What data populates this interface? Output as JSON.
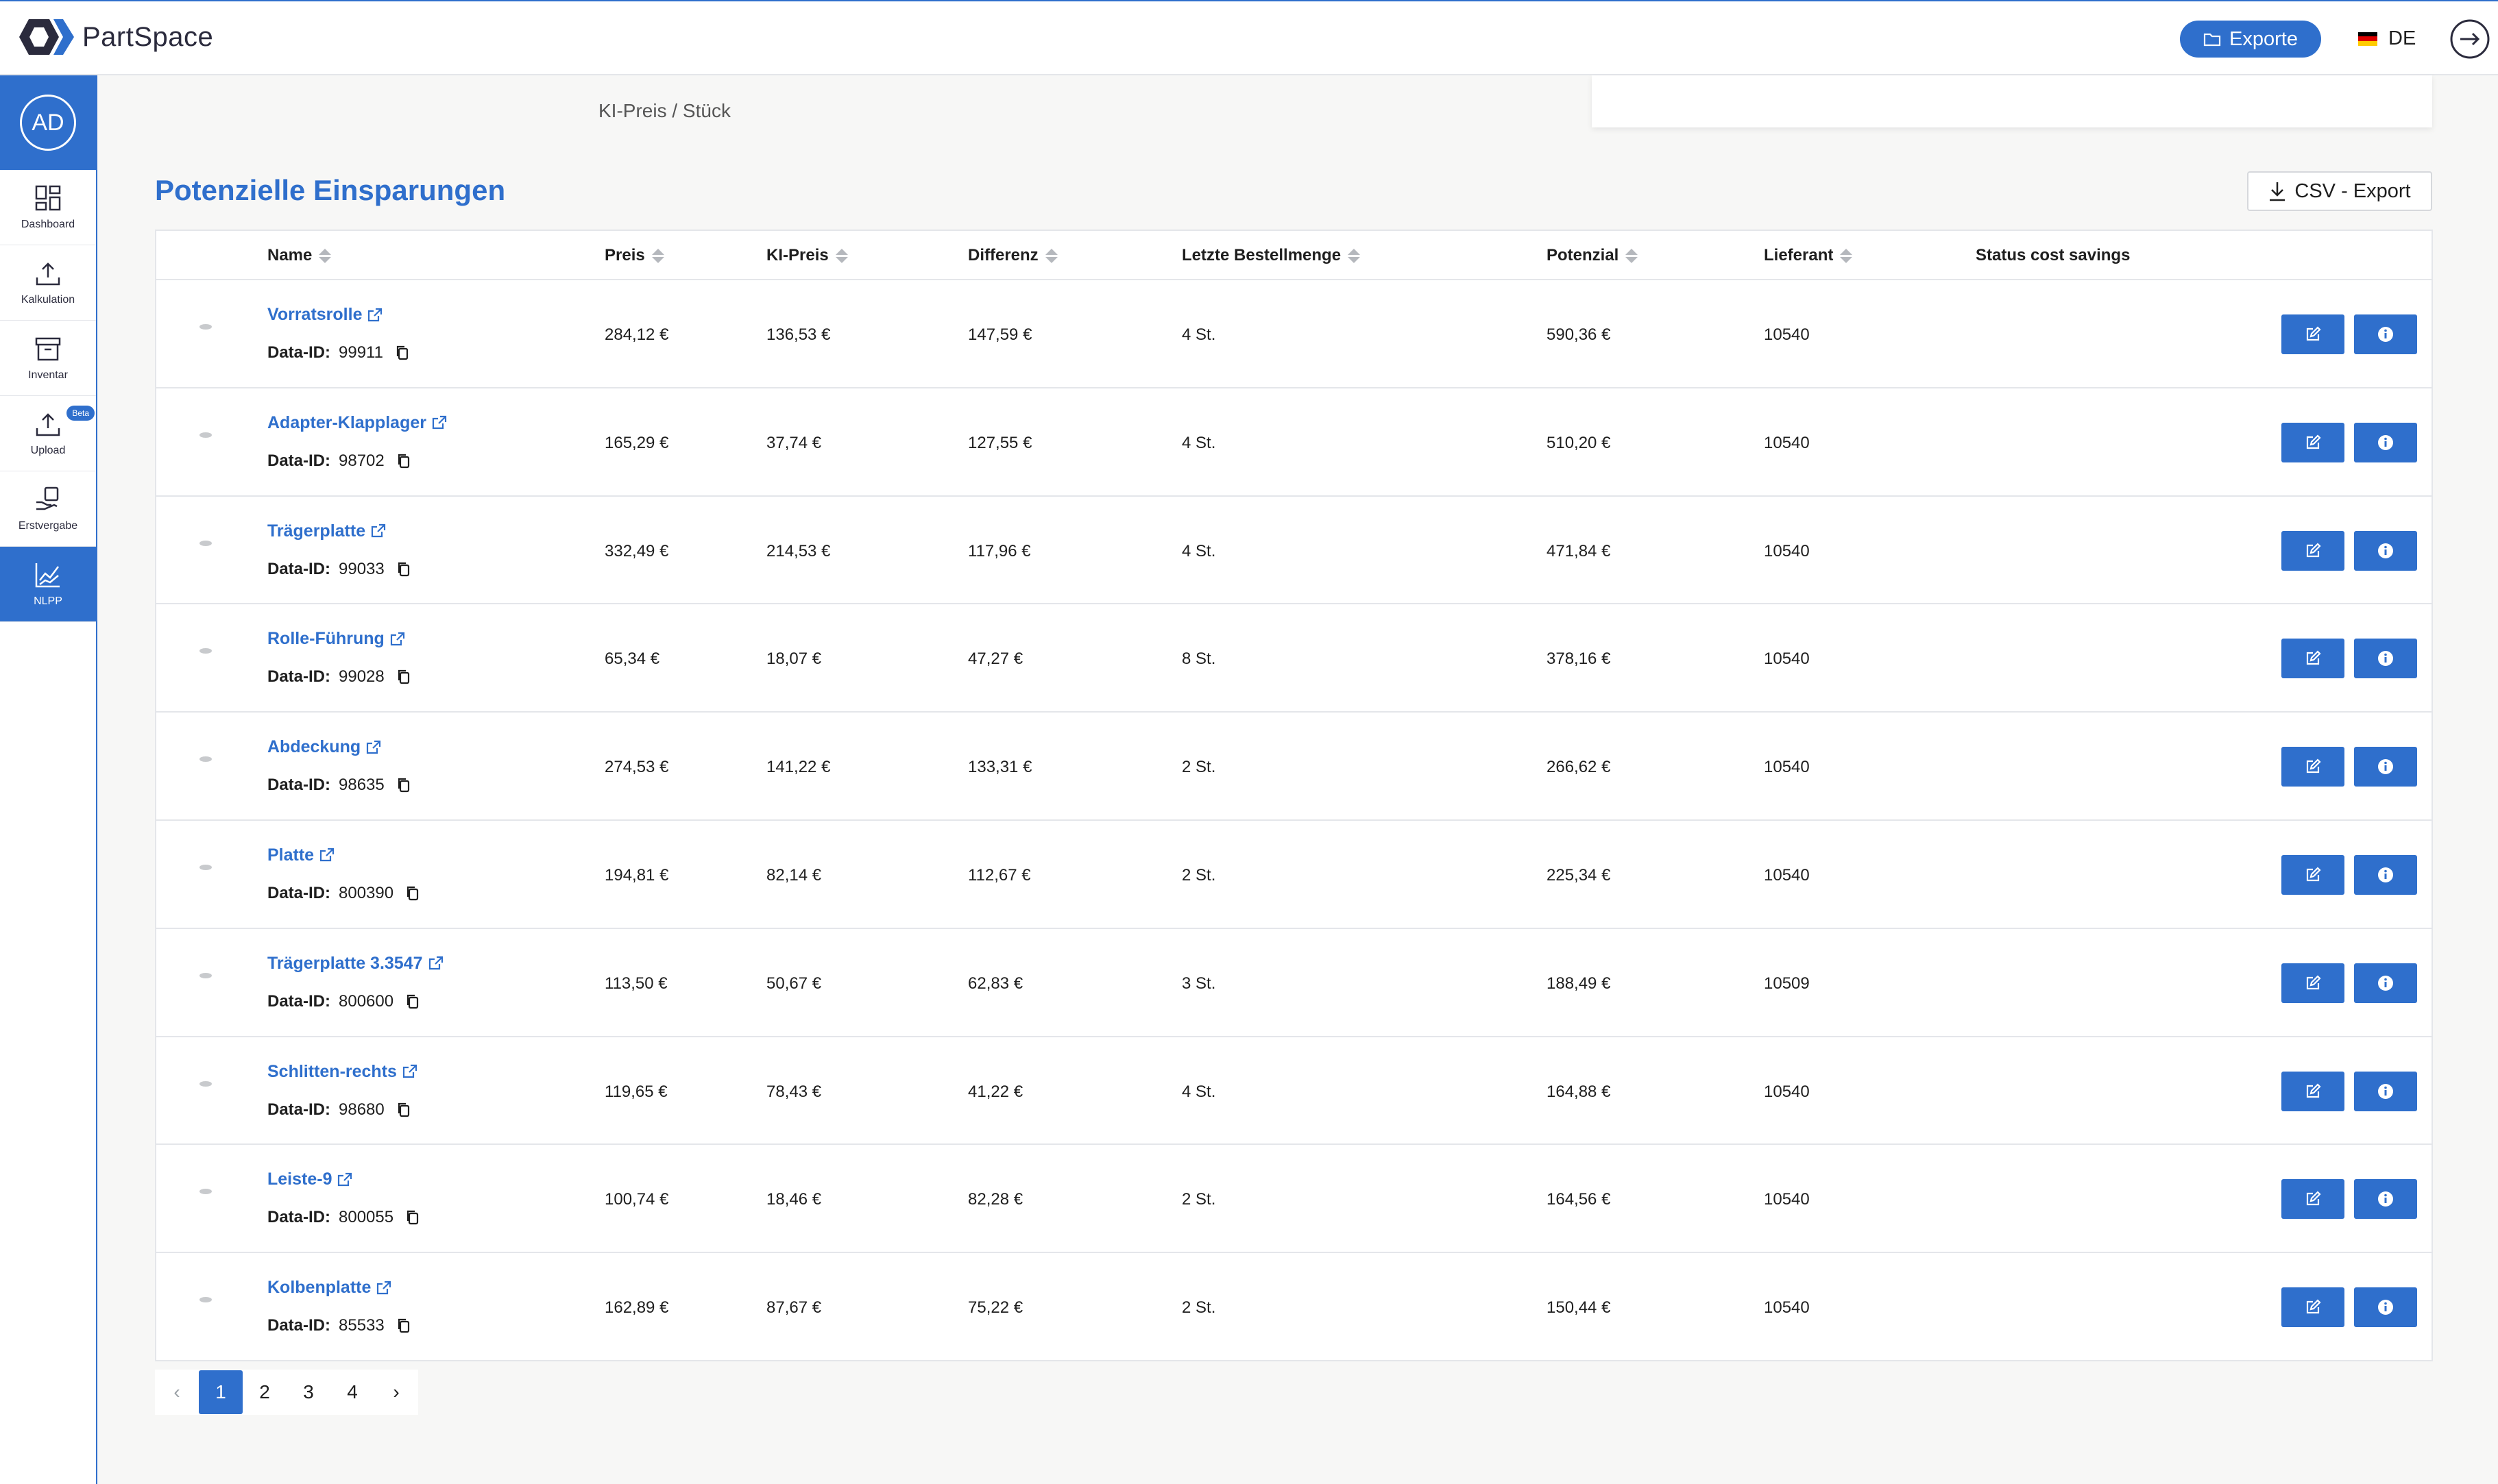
{
  "app": {
    "name": "PartSpace"
  },
  "header": {
    "exports_label": "Exporte",
    "language": "DE"
  },
  "user": {
    "initials": "AD"
  },
  "sidebar": {
    "items": [
      {
        "label": "Dashboard",
        "icon": "dashboard-icon",
        "active": false
      },
      {
        "label": "Kalkulation",
        "icon": "upload-icon",
        "active": false
      },
      {
        "label": "Inventar",
        "icon": "archive-icon",
        "active": false
      },
      {
        "label": "Upload",
        "icon": "upload-icon",
        "active": false,
        "badge": "Beta"
      },
      {
        "label": "Erstvergabe",
        "icon": "hand-coins-icon",
        "active": false
      },
      {
        "label": "NLPP",
        "icon": "chart-line-icon",
        "active": true
      }
    ]
  },
  "breadcrumb": {
    "text": "KI-Preis / Stück"
  },
  "section": {
    "title": "Potenzielle Einsparungen",
    "csv_export_label": "CSV - Export"
  },
  "table": {
    "columns": [
      "Name",
      "Preis",
      "KI-Preis",
      "Differenz",
      "Letzte Bestellmenge",
      "Potenzial",
      "Lieferant",
      "Status cost savings"
    ],
    "dataid_label": "Data-ID:",
    "rows": [
      {
        "name": "Vorratsrolle",
        "data_id": "99911",
        "preis": "284,12 €",
        "ki_preis": "136,53 €",
        "differenz": "147,59 €",
        "menge": "4 St.",
        "potenzial": "590,36 €",
        "lieferant": "10540"
      },
      {
        "name": "Adapter-Klapplager",
        "data_id": "98702",
        "preis": "165,29 €",
        "ki_preis": "37,74 €",
        "differenz": "127,55 €",
        "menge": "4 St.",
        "potenzial": "510,20 €",
        "lieferant": "10540"
      },
      {
        "name": "Trägerplatte",
        "data_id": "99033",
        "preis": "332,49 €",
        "ki_preis": "214,53 €",
        "differenz": "117,96 €",
        "menge": "4 St.",
        "potenzial": "471,84 €",
        "lieferant": "10540"
      },
      {
        "name": "Rolle-Führung",
        "data_id": "99028",
        "preis": "65,34 €",
        "ki_preis": "18,07 €",
        "differenz": "47,27 €",
        "menge": "8 St.",
        "potenzial": "378,16 €",
        "lieferant": "10540"
      },
      {
        "name": "Abdeckung",
        "data_id": "98635",
        "preis": "274,53 €",
        "ki_preis": "141,22 €",
        "differenz": "133,31 €",
        "menge": "2 St.",
        "potenzial": "266,62 €",
        "lieferant": "10540"
      },
      {
        "name": "Platte",
        "data_id": "800390",
        "preis": "194,81 €",
        "ki_preis": "82,14 €",
        "differenz": "112,67 €",
        "menge": "2 St.",
        "potenzial": "225,34 €",
        "lieferant": "10540"
      },
      {
        "name": "Trägerplatte 3.3547",
        "data_id": "800600",
        "preis": "113,50 €",
        "ki_preis": "50,67 €",
        "differenz": "62,83 €",
        "menge": "3 St.",
        "potenzial": "188,49 €",
        "lieferant": "10509"
      },
      {
        "name": "Schlitten-rechts",
        "data_id": "98680",
        "preis": "119,65 €",
        "ki_preis": "78,43 €",
        "differenz": "41,22 €",
        "menge": "4 St.",
        "potenzial": "164,88 €",
        "lieferant": "10540"
      },
      {
        "name": "Leiste-9",
        "data_id": "800055",
        "preis": "100,74 €",
        "ki_preis": "18,46 €",
        "differenz": "82,28 €",
        "menge": "2 St.",
        "potenzial": "164,56 €",
        "lieferant": "10540"
      },
      {
        "name": "Kolbenplatte",
        "data_id": "85533",
        "preis": "162,89 €",
        "ki_preis": "87,67 €",
        "differenz": "75,22 €",
        "menge": "2 St.",
        "potenzial": "150,44 €",
        "lieferant": "10540"
      }
    ]
  },
  "pagination": {
    "pages": [
      "1",
      "2",
      "3",
      "4"
    ],
    "current": "1"
  },
  "colors": {
    "accent": "#2f6fcc",
    "background": "#f7f7f6"
  }
}
